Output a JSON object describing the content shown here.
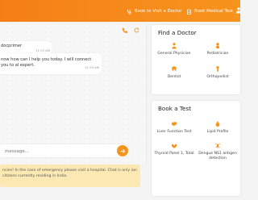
{
  "colors": {
    "brand_orange": "#f7941d",
    "disclaimer_bg": "#fbe8b2"
  },
  "topbar": {
    "links": [
      {
        "label": "Book to Visit a Doctor",
        "icon": "stethoscope-icon"
      },
      {
        "label": "Book Medical Test",
        "icon": "clipboard-icon"
      }
    ]
  },
  "chat": {
    "messages": [
      {
        "text": "docprimer",
        "time": "11:33 AM"
      },
      {
        "text": "now how can I help you today. I will connect you to al expert.",
        "time": "11:33 AM"
      }
    ],
    "input_placeholder": "message...",
    "disclaimer": "ncies! In the case of emergency please visit a hospital. Chat is only ian citizens currently residing in India."
  },
  "find_doctor": {
    "title": "Find a Doctor",
    "items": [
      {
        "label": "General Physician",
        "icon": "doctor-icon"
      },
      {
        "label": "Pediatrician",
        "icon": "baby-icon"
      },
      {
        "label": "Dentist",
        "icon": "tooth-icon"
      },
      {
        "label": "Orthopedist",
        "icon": "bone-icon"
      }
    ]
  },
  "book_test": {
    "title": "Book a Test",
    "items": [
      {
        "label": "Liver Function Test",
        "icon": "liver-icon"
      },
      {
        "label": "Lipid Profile",
        "icon": "blood-drop-icon"
      },
      {
        "label": "Thyroid Panel 1, Total",
        "icon": "thyroid-icon"
      },
      {
        "label": "Dengue NS1 antigen detection",
        "icon": "mosquito-icon"
      }
    ]
  }
}
